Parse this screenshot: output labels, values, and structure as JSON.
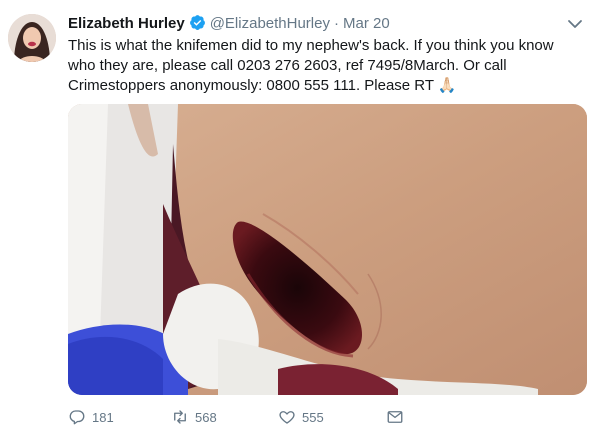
{
  "tweet": {
    "author_name": "Elizabeth Hurley",
    "author_handle": "@ElizabethHurley",
    "separator": "·",
    "date": "Mar 20",
    "text": "This is what the knifemen did to my nephew's back. If you think you know who they are, please call 0203 276 2603, ref 7495/8March. Or call Crimestoppers anonymously: 0800 555 111. Please RT 🙏🏻",
    "icons": {
      "verified": "verified-badge-icon",
      "caret": "chevron-down-icon",
      "reply": "reply-icon",
      "retweet": "retweet-icon",
      "like": "heart-icon",
      "dm": "envelope-icon"
    },
    "stats": {
      "replies": "181",
      "retweets": "568",
      "likes": "555"
    },
    "colors": {
      "verified_blue": "#1da1f2",
      "muted_gray": "#657786",
      "text": "#14171a"
    }
  }
}
